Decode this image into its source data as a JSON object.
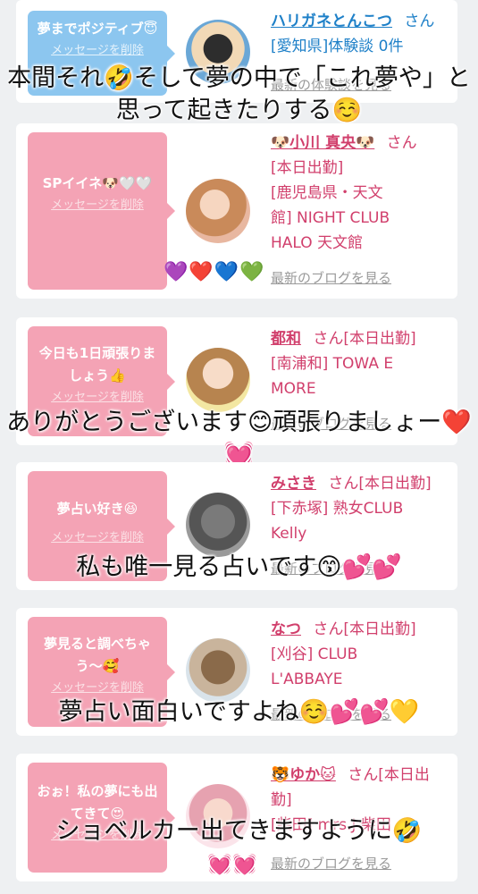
{
  "entries": [
    {
      "bubble_text": "夢までポジティブ😇",
      "delete_label": "メッセージを削除",
      "name": "ハリガネとんこつ",
      "san": "さん",
      "lines": [
        "[愛知県]体験談 0件"
      ],
      "blog_link": "最新の体験談を見る"
    },
    {
      "bubble_text": "SPイイネ🐶🤍🤍",
      "delete_label": "メッセージを削除",
      "name": "🐶小川 真央🐶",
      "san": "さん",
      "lines": [
        "[本日出勤]",
        "[鹿児島県・天文",
        "館] NIGHT CLUB",
        "HALO 天文館"
      ],
      "blog_link": "最新のブログを見る"
    },
    {
      "bubble_text": "今日も1日頑張りましょう👍",
      "delete_label": "メッセージを削除",
      "name": "都和",
      "san": "さん[本日出勤]",
      "lines": [
        "[南浦和] TOWA E",
        "MORE"
      ],
      "blog_link": "最新のブログを見る"
    },
    {
      "bubble_text": "夢占い好き😆",
      "delete_label": "メッセージを削除",
      "name": "みさき",
      "san": "さん[本日出勤]",
      "lines": [
        "[下赤塚] 熟女CLUB",
        "Kelly"
      ],
      "blog_link": "最新のブログを見る"
    },
    {
      "bubble_text": "夢見ると調べちゃう〜🥰",
      "delete_label": "メッセージを削除",
      "name": "なつ",
      "san": "さん[本日出勤]",
      "lines": [
        "[刈谷] CLUB",
        "L'ABBAYE"
      ],
      "blog_link": "最新のブログを見る"
    },
    {
      "bubble_text": "おぉ！私の夢にも出てきて😍",
      "delete_label": "メッセージを削除",
      "name": "🐯ゆか🐱",
      "san": "さん[本日出",
      "lines": [
        "勤]",
        "[柴田] mrs.J 柴田"
      ],
      "blog_link": "最新のブログを見る"
    }
  ],
  "captions": [
    "本間それ🤣そして夢の中で「これ夢や」と思って起きたりする☺️",
    "ありがとうございます😊頑張りましょー❤️💓",
    "私も唯一見る占いです😙💕💕",
    "夢占い面白いですよね☺️💕💕💛",
    "ショベルカー出てきますように🤣"
  ],
  "hearts": [
    "💜❤️💙💚",
    "💓💓"
  ],
  "colors": {
    "bubble_first": "#8cc6ef",
    "bubble_pink": "#f4a3b5",
    "name_pink": "#d13f6c",
    "first_name_blue": "#1e80c8"
  }
}
